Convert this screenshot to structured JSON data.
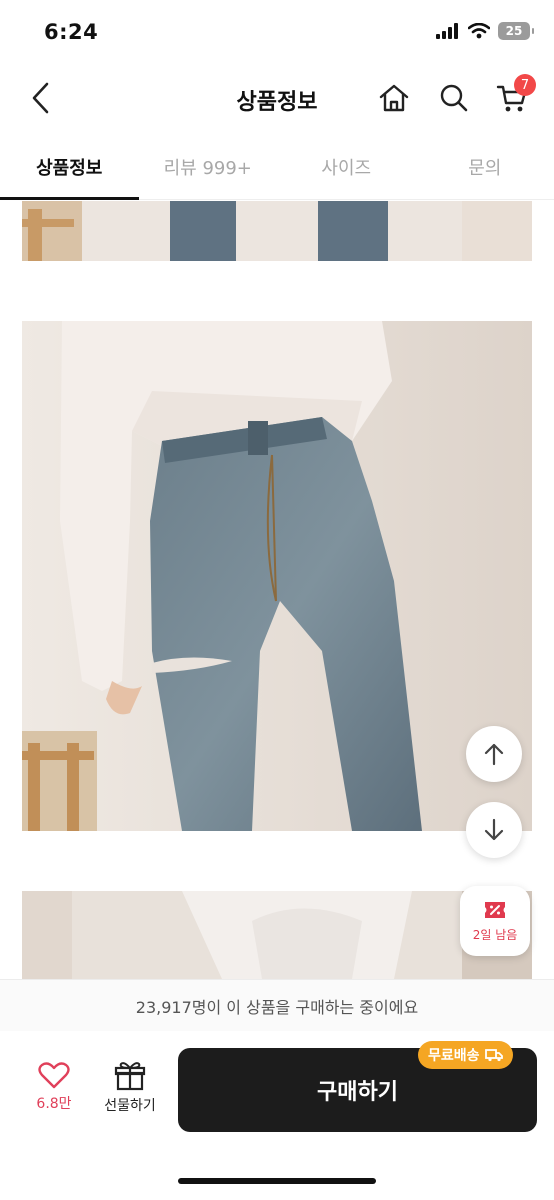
{
  "status_bar": {
    "time": "6:24",
    "battery": "25"
  },
  "header": {
    "title": "상품정보",
    "cart_count": "7"
  },
  "tabs": [
    {
      "label": "상품정보",
      "active": true
    },
    {
      "label": "리뷰 999+",
      "active": false
    },
    {
      "label": "사이즈",
      "active": false
    },
    {
      "label": "문의",
      "active": false
    }
  ],
  "floating": {
    "coupon_label": "2일 남음"
  },
  "notice": {
    "text": "23,917명이 이 상품을 구매하는 중이에요"
  },
  "bottom_bar": {
    "like_count": "6.8만",
    "gift_label": "선물하기",
    "buy_label": "구매하기",
    "free_shipping_label": "무료배송"
  },
  "colors": {
    "accent_red": "#f24848",
    "like_pink": "#e0405a",
    "shipping_orange": "#f5a623",
    "buy_button": "#1c1c1c"
  },
  "icons": [
    "back-icon",
    "home-icon",
    "search-icon",
    "cart-icon",
    "arrow-up-icon",
    "arrow-down-icon",
    "coupon-icon",
    "heart-icon",
    "gift-icon",
    "truck-icon"
  ]
}
